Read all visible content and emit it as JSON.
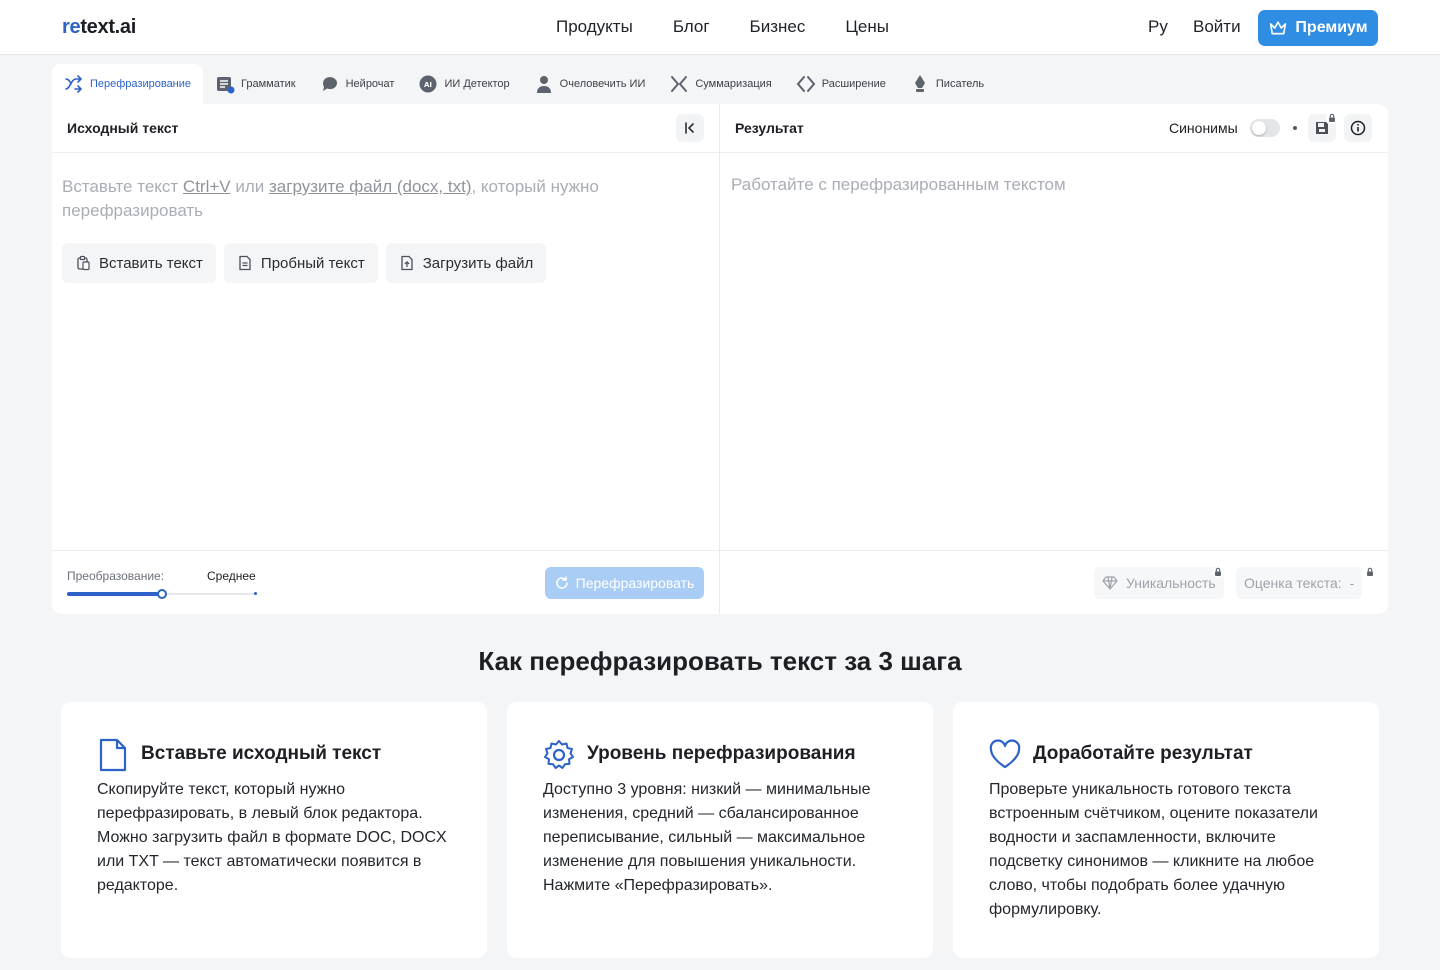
{
  "header": {
    "logo_prefix": "re",
    "logo_rest": "text.ai",
    "nav": [
      "Продукты",
      "Блог",
      "Бизнес",
      "Цены"
    ],
    "lang": "Ру",
    "login": "Войти",
    "premium": "Премиум",
    "accent_color": "#2f8de4"
  },
  "tabs": [
    {
      "label": "Перефразирование",
      "icon": "paraphrase-icon",
      "active": true
    },
    {
      "label": "Грамматик",
      "icon": "grammar-icon",
      "active": false
    },
    {
      "label": "Нейрочат",
      "icon": "chat-icon",
      "active": false
    },
    {
      "label": "ИИ Детектор",
      "icon": "ai-detector-icon",
      "active": false
    },
    {
      "label": "Очеловечить ИИ",
      "icon": "humanize-icon",
      "active": false
    },
    {
      "label": "Суммаризация",
      "icon": "summarize-icon",
      "active": false
    },
    {
      "label": "Расширение",
      "icon": "expand-icon",
      "active": false
    },
    {
      "label": "Писатель",
      "icon": "writer-icon",
      "active": false
    }
  ],
  "source": {
    "title": "Исходный текст",
    "placeholder_a": "Вставьте текст ",
    "placeholder_link1": "Ctrl+V",
    "placeholder_b": " или ",
    "placeholder_link2": "загрузите файл (docx, txt)",
    "placeholder_c": ", который нужно перефразировать",
    "actions": {
      "paste": "Вставить текст",
      "sample": "Пробный текст",
      "upload": "Загрузить файл"
    },
    "mode_label": "Преобразование:",
    "mode_value": "Среднее",
    "mode_level": 0.5,
    "rephrase_button": "Перефразировать"
  },
  "result": {
    "title": "Результат",
    "synonyms_label": "Синонимы",
    "synonyms_on": false,
    "placeholder": "Работайте с перефразированным текстом",
    "uniqueness": "Уникальность",
    "score_label": "Оценка текста:",
    "score_value": "-"
  },
  "howto": {
    "title": "Как перефразировать текст за 3 шага",
    "steps": [
      {
        "icon": "document-icon",
        "title": "Вставьте исходный текст",
        "text": "Скопируйте текст, который нужно перефразировать, в левый блок редактора. Можно загрузить файл в формате DOC, DOCX или TXT — текст автоматически появится в редакторе."
      },
      {
        "icon": "gear-icon",
        "title": "Уровень перефразирования",
        "text": "Доступно 3 уровня: низкий — минимальные изменения, средний — сбалансированное переписывание, сильный — максимальное изменение для повышения уникальности. Нажмите «Перефразировать»."
      },
      {
        "icon": "heart-icon",
        "title": "Доработайте результат",
        "text": "Проверьте уникальность готового текста встроенным счётчиком, оцените показатели водности и заспамленности, включите подсветку синонимов — кликните на любое слово, чтобы подобрать более удачную формулировку."
      }
    ]
  }
}
